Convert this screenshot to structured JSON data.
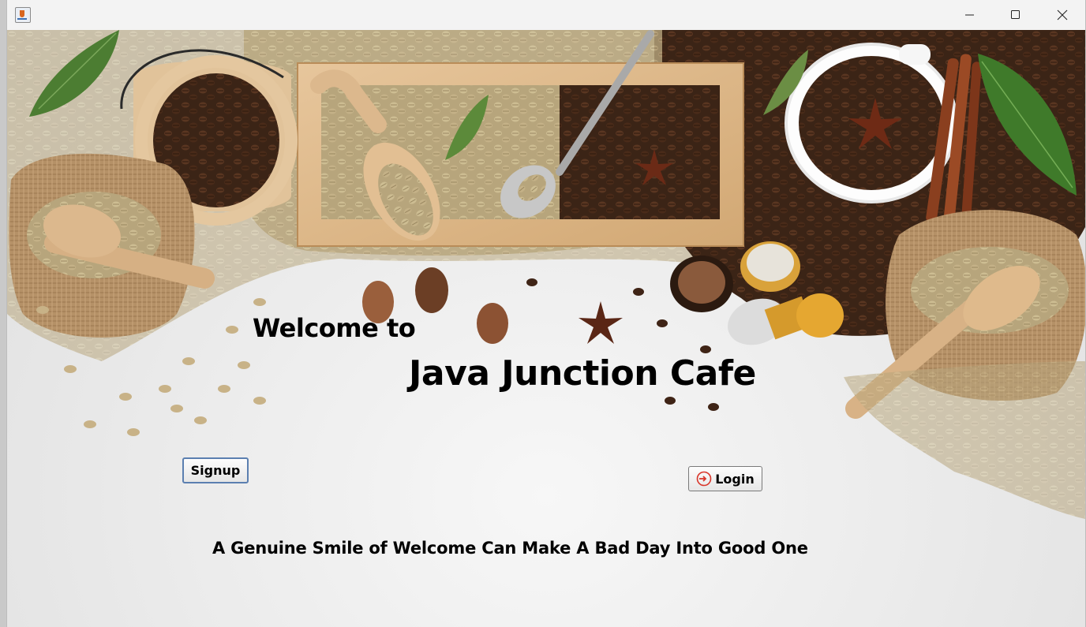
{
  "window": {
    "title": "",
    "controls": [
      "minimize-icon",
      "maximize-icon",
      "close-icon"
    ]
  },
  "content": {
    "welcome_text": "Welcome to",
    "cafe_name": "Java Junction Cafe",
    "tagline": "A Genuine Smile of Welcome Can Make A Bad Day Into Good One"
  },
  "buttons": {
    "signup_label": "Signup",
    "login_label": "Login",
    "login_icon": "login-arrow-icon"
  },
  "colors": {
    "text": "#000000",
    "login_icon": "#d9362b",
    "signup_border": "#5b7fb0"
  }
}
